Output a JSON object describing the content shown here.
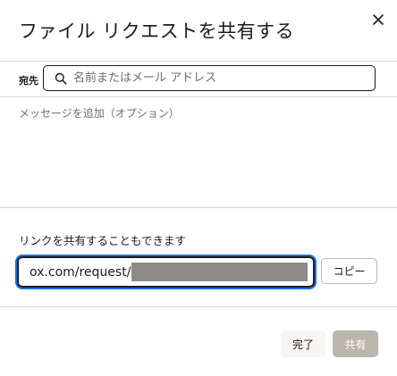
{
  "dialog": {
    "title": "ファイル リクエストを共有する",
    "close_icon": "close-icon"
  },
  "recipients": {
    "label": "宛先",
    "placeholder": "名前またはメール アドレス",
    "icon": "search-icon"
  },
  "message": {
    "placeholder": "メッセージを追加（オプション）"
  },
  "link": {
    "label": "リンクを共有することもできます",
    "url_visible": "ox.com/request/",
    "copy_label": "コピー"
  },
  "footer": {
    "done_label": "完了",
    "share_label": "共有"
  },
  "colors": {
    "focus_ring": "#1b70e8",
    "share_disabled": "#bbb5ae",
    "divider": "#dcd8d3"
  }
}
